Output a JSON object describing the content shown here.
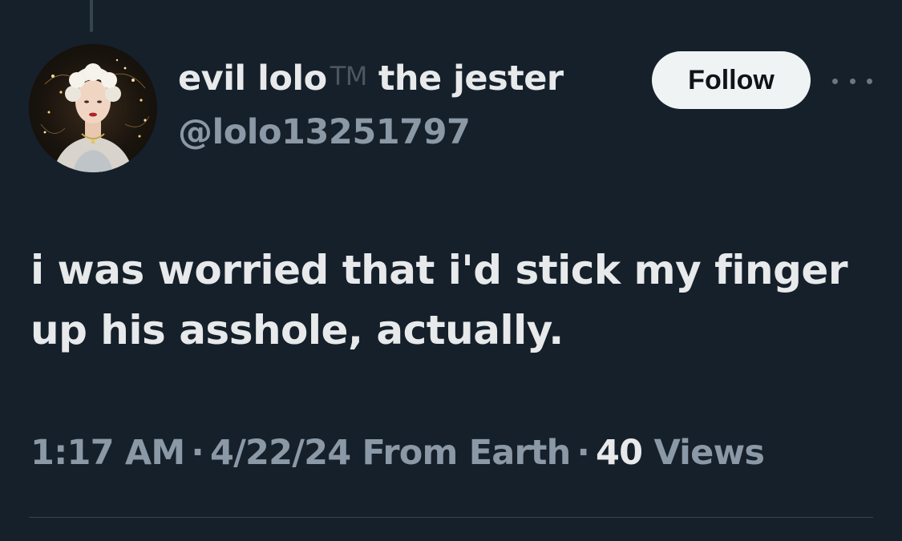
{
  "author": {
    "display_name": "evil lolo",
    "trademark": "TM",
    "display_name_suffix": "the jester",
    "handle": "@lolo13251797",
    "avatar_icon": "profile-avatar"
  },
  "actions": {
    "follow_label": "Follow",
    "more_icon": "more-dots-icon"
  },
  "tweet": {
    "text": "i was worried that i'd stick my finger up his asshole, actually."
  },
  "meta": {
    "time": "1:17 AM",
    "separator": "·",
    "date": "4/22/24",
    "source": "From Earth",
    "views_count": "40",
    "views_label": "Views"
  },
  "colors": {
    "background": "#15202b",
    "primary_text": "#e7e9ea",
    "secondary_text": "#8b98a5",
    "button_bg": "#eff3f4"
  }
}
